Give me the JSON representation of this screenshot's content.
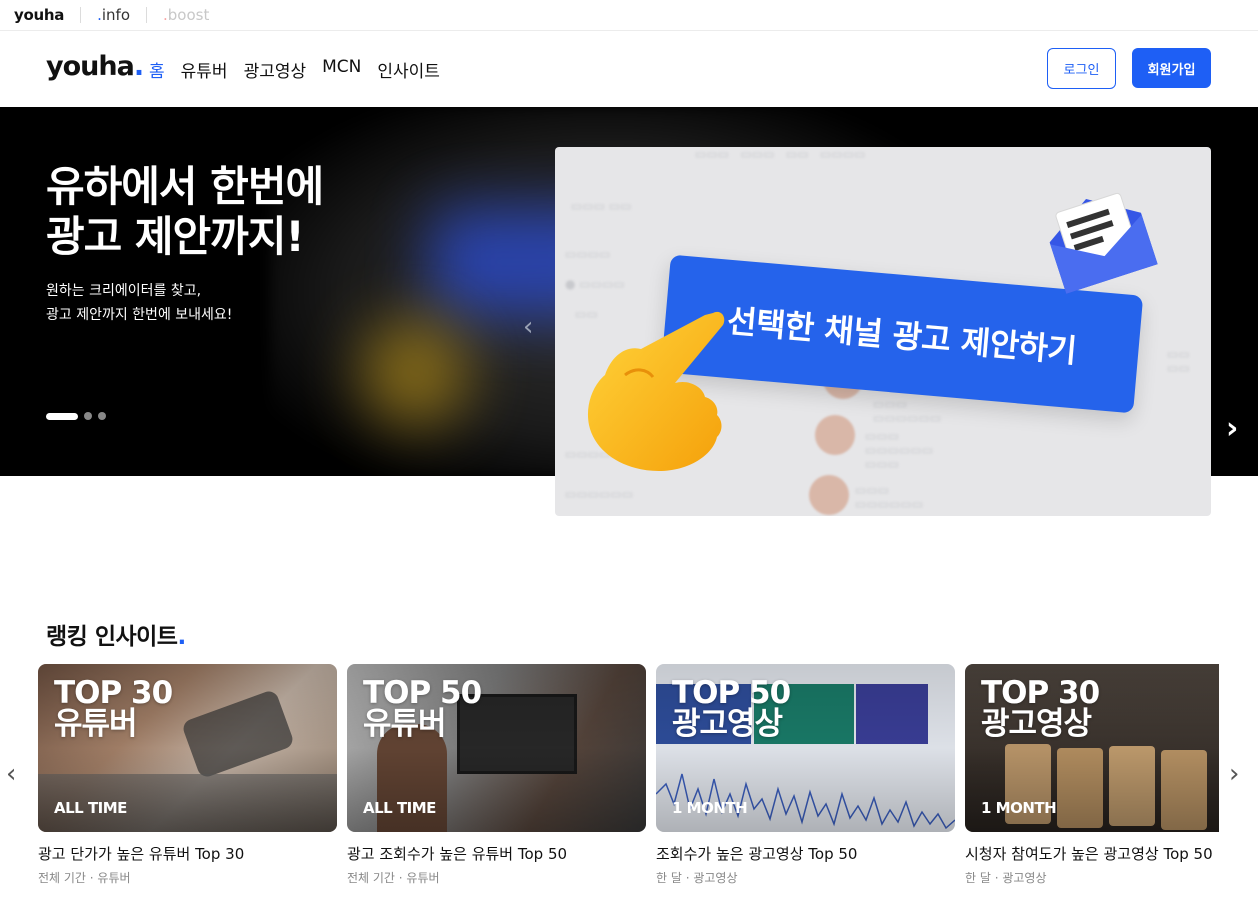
{
  "topbar": {
    "brand": "youha",
    "links": [
      {
        "dot": ".",
        "label": "info"
      },
      {
        "dot": ".",
        "label": "boost"
      }
    ]
  },
  "header": {
    "logo": "youha",
    "logo_dot": ".",
    "nav": [
      "홈",
      "유튜버",
      "광고영상",
      "MCN",
      "인사이트"
    ],
    "login": "로그인",
    "signup": "회원가입"
  },
  "hero": {
    "title_line1": "유하에서 한번에",
    "title_line2": "광고 제안까지!",
    "subtitle_line1": "원하는 크리에이터를 찾고,",
    "subtitle_line2": "광고 제안까지 한번에 보내세요!",
    "cta": "선택한 채널 광고 제안하기",
    "slides": 3,
    "active_slide": 1
  },
  "ranking": {
    "title": "랭킹 인사이트",
    "title_dot": ".",
    "cards": [
      {
        "big1": "TOP 30",
        "big2": "유튜버",
        "period": "ALL TIME",
        "title": "광고 단가가 높은 유튜버 Top 30",
        "meta": "전체 기간 · 유튜버"
      },
      {
        "big1": "TOP 50",
        "big2": "유튜버",
        "period": "ALL TIME",
        "title": "광고 조회수가 높은 유튜버 Top 50",
        "meta": "전체 기간 · 유튜버"
      },
      {
        "big1": "TOP 50",
        "big2": "광고영상",
        "period": "1 MONTH",
        "title": "조회수가 높은 광고영상 Top 50",
        "meta": "한 달 · 광고영상"
      },
      {
        "big1": "TOP 30",
        "big2": "광고영상",
        "period": "1 MONTH",
        "title": "시청자 참여도가 높은 광고영상 Top 50",
        "meta": "한 달 · 광고영상"
      }
    ]
  },
  "colors": {
    "accent": "#1e5ff5",
    "cta": "#2563eb"
  }
}
